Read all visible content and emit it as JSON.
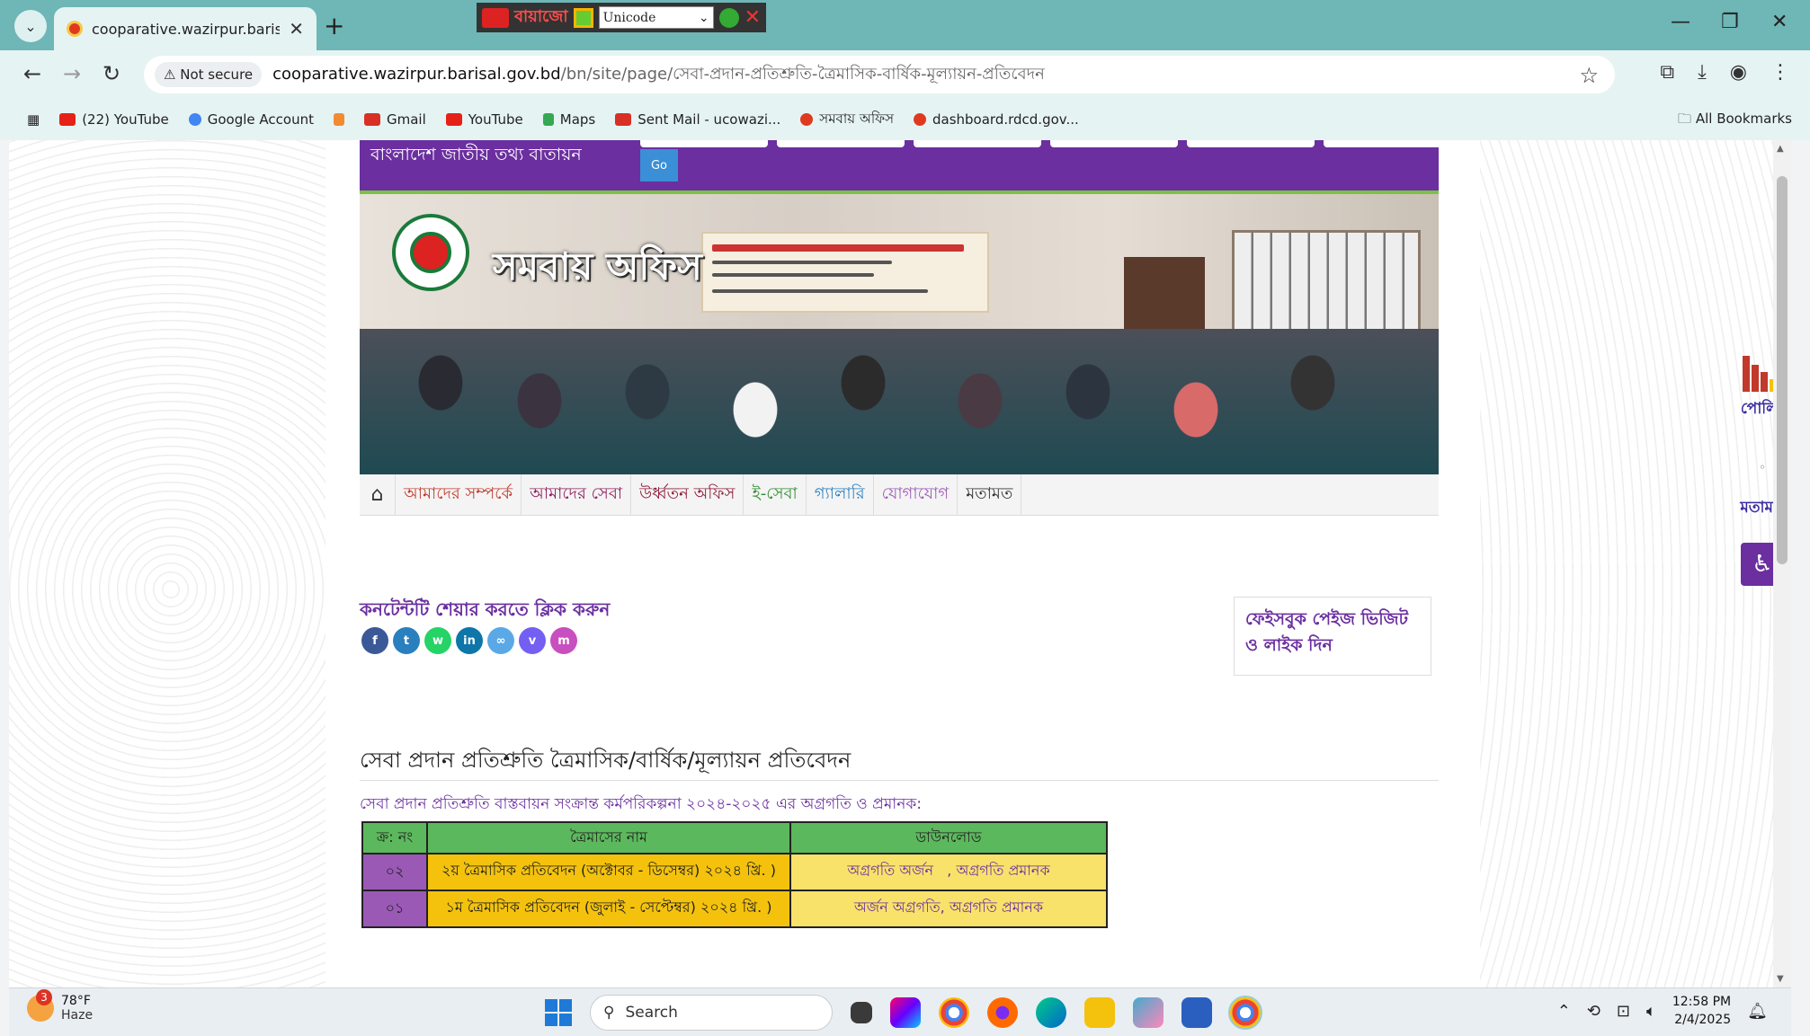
{
  "browser": {
    "tab_title": "cooparative.wazirpur.barisal.go",
    "new_tab": "+",
    "ime": {
      "label": "বায়াজো",
      "encoding": "Unicode"
    },
    "not_secure": "Not secure",
    "url_host": "cooparative.wazirpur.barisal.gov.bd",
    "url_path": "/bn/site/page/সেবা-প্রদান-প্রতিশ্রুতি-ত্রৈমাসিক-বার্ষিক-মূল্যায়ন-প্রতিবেদন",
    "bookmarks": [
      {
        "label": "(22) YouTube",
        "color": "#e62117"
      },
      {
        "label": "Google Account",
        "color": "#4285f4"
      },
      {
        "label": "",
        "color": "#f28b30"
      },
      {
        "label": "Gmail",
        "color": "#d93025"
      },
      {
        "label": "YouTube",
        "color": "#e62117"
      },
      {
        "label": "Maps",
        "color": "#34a853"
      },
      {
        "label": "Sent Mail - ucowazi...",
        "color": "#d93025"
      },
      {
        "label": "সমবায় অফিস",
        "color": "#e03a1e"
      },
      {
        "label": "dashboard.rdcd.gov...",
        "color": "#e03a1e"
      }
    ],
    "all_bookmarks": "All Bookmarks"
  },
  "site": {
    "topbar_title": "বাংলাদেশ জাতীয় তথ্য বাতায়ন",
    "go_label": "Go",
    "banner_title": "সমবায় অফিস",
    "menu": [
      {
        "label": "আমাদের সম্পর্কে",
        "color": "#c0392b"
      },
      {
        "label": "আমাদের সেবা",
        "color": "#8e1b5c"
      },
      {
        "label": "উর্ধ্বতন অফিস",
        "color": "#8e1b3a"
      },
      {
        "label": "ই-সেবা",
        "color": "#2e8b2e"
      },
      {
        "label": "গ্যালারি",
        "color": "#2a7fbf"
      },
      {
        "label": "যোগাযোগ",
        "color": "#9b59b6"
      },
      {
        "label": "মতামত",
        "color": "#333333"
      }
    ],
    "share_title": "কনটেন্টটি শেয়ার করতে ক্লিক করুন",
    "share_icons": [
      {
        "name": "facebook-icon",
        "glyph": "f",
        "color": "#3b5998"
      },
      {
        "name": "twitter-icon",
        "glyph": "t",
        "color": "#2a7fbf"
      },
      {
        "name": "whatsapp-icon",
        "glyph": "w",
        "color": "#25d366"
      },
      {
        "name": "linkedin-icon",
        "glyph": "in",
        "color": "#0e76a8"
      },
      {
        "name": "link-icon",
        "glyph": "∞",
        "color": "#5aa9e6"
      },
      {
        "name": "viber-icon",
        "glyph": "v",
        "color": "#7360f2"
      },
      {
        "name": "messenger-icon",
        "glyph": "m",
        "color": "#c84fbf"
      }
    ],
    "fb_box": "ফেইসবুক পেইজ ভিজিট ও লাইক দিন",
    "content_title": "সেবা প্রদান প্রতিশ্রুতি ত্রৈমাসিক/বার্ষিক/মূল্যায়ন প্রতিবেদন",
    "content_sub": "সেবা প্রদান প্রতিশ্রুতি বাস্তবায়ন সংক্রান্ত কর্মপরিকল্পনা ২০২৪-২০২৫ এর অগ্রগতি ও প্রমানক:",
    "table": {
      "headers": [
        "ক্র: নং",
        "ত্রৈমাসের নাম",
        "ডাউনলোড"
      ],
      "rows": [
        {
          "sl": "০২",
          "name": "২য় ত্রৈমাসিক প্রতিবেদন (অক্টোবর - ডিসেম্বর) ২০২৪ খ্রি. )",
          "dl_a": "অগ্রগতি অর্জন",
          "dl_b": ", অগ্রগতি প্রমানক"
        },
        {
          "sl": "০১",
          "name": "১ম ত্রৈমাসিক প্রতিবেদন (জুলাই - সেপ্টেম্বর) ২০২৪ খ্রি. )",
          "dl_a": "অর্জন অগ্রগতি,",
          "dl_b": "অগ্রগতি প্রমানক"
        }
      ]
    },
    "widgets": {
      "poll": "পোলিং",
      "opinion": "মতামত"
    }
  },
  "taskbar": {
    "weather_temp": "78°F",
    "weather_desc": "Haze",
    "weather_badge": "3",
    "search": "Search",
    "time": "12:58 PM",
    "date": "2/4/2025"
  }
}
